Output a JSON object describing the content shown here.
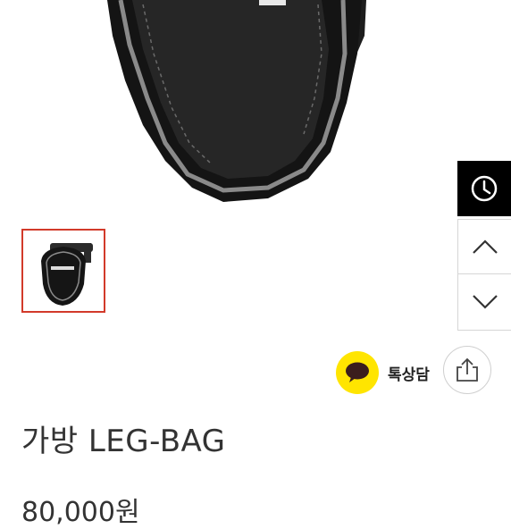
{
  "product": {
    "title": "가방 LEG-BAG",
    "price": "80,000원"
  },
  "actions": {
    "talk_label": "톡상담"
  },
  "icons": {
    "recent": "clock-icon",
    "scroll_up": "chevron-up-icon",
    "scroll_down": "chevron-down-icon",
    "talk": "kakao-talk-icon",
    "share": "share-icon"
  },
  "colors": {
    "thumb_border": "#d23a2a",
    "kakao_yellow": "#ffe500",
    "recent_bg": "#000000"
  }
}
